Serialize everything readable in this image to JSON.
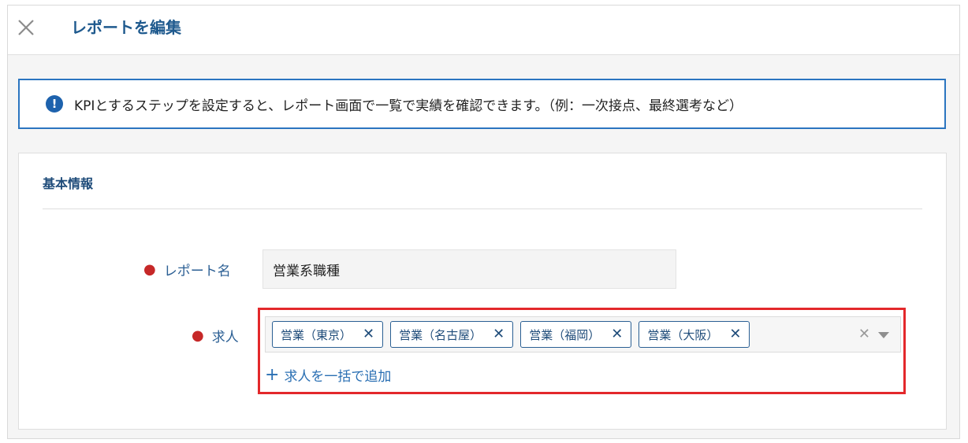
{
  "header": {
    "title": "レポートを編集",
    "close_icon": "close-icon"
  },
  "banner": {
    "icon": "exclamation-circle-icon",
    "icon_glyph": "!",
    "text": "KPIとするステップを設定すると、レポート画面で一覧で実績を確認できます。（例：一次接点、最終選考など）"
  },
  "section": {
    "title": "基本情報",
    "report_name": {
      "label": "レポート名",
      "value": "営業系職種"
    },
    "jobs": {
      "label": "求人",
      "tags": [
        {
          "label": "営業（東京）"
        },
        {
          "label": "営業（名古屋）"
        },
        {
          "label": "営業（福岡）"
        },
        {
          "label": "営業（大阪）"
        }
      ],
      "bulk_add_label": "求人を一括で追加"
    }
  },
  "colors": {
    "accent": "#2b75c0",
    "title": "#1f5a8e",
    "required": "#c62828",
    "highlight": "#e3282b"
  }
}
